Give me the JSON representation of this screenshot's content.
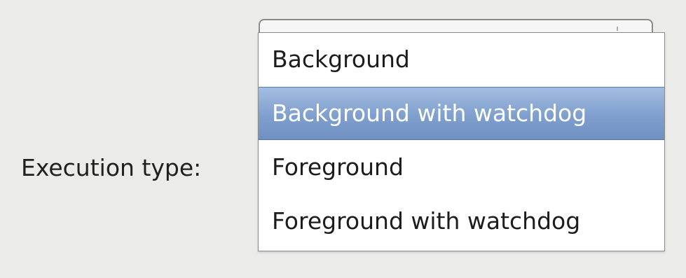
{
  "form": {
    "execution_type_label": "Execution type:"
  },
  "dropdown": {
    "options": [
      "Background",
      "Background with watchdog",
      "Foreground",
      "Foreground with watchdog"
    ],
    "highlighted_option": "Background with watchdog"
  },
  "colors": {
    "window_background": "#ebebea",
    "selection_top": "#a3bde0",
    "selection_bottom": "#6f90c2",
    "selection_text": "#ffffff"
  }
}
